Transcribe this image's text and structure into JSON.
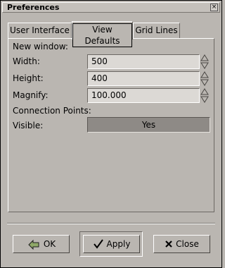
{
  "window": {
    "title": "Preferences",
    "close_glyph": "×"
  },
  "tabs": [
    {
      "label": "User Interface",
      "active": false
    },
    {
      "label": "View Defaults",
      "active": true
    },
    {
      "label": "Grid Lines",
      "active": false
    }
  ],
  "view_defaults": {
    "new_window_heading": "New window:",
    "width": {
      "label": "Width:",
      "value": "500"
    },
    "height": {
      "label": "Height:",
      "value": "400"
    },
    "magnify": {
      "label": "Magnify:",
      "value": "100.000"
    },
    "connection_points_heading": "Connection Points:",
    "visible": {
      "label": "Visible:",
      "value": "Yes"
    }
  },
  "buttons": {
    "ok": {
      "label": "OK",
      "icon": "ok-arrow-icon"
    },
    "apply": {
      "label": "Apply",
      "icon": "checkmark-icon"
    },
    "close": {
      "label": "Close",
      "icon": "x-close-icon"
    }
  },
  "colors": {
    "background": "#bab6b1",
    "field": "#dcd9d5",
    "toggle_active": "#8e8a86"
  }
}
